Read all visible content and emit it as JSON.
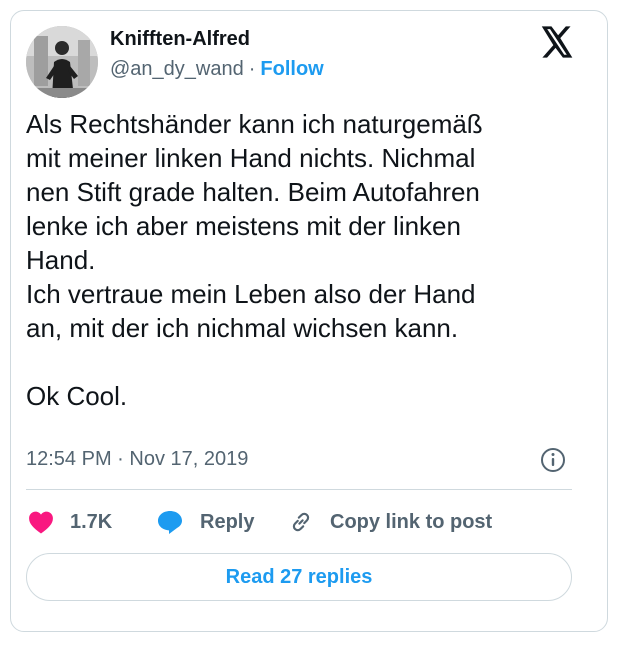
{
  "author": {
    "display_name": "Knifften-Alfred",
    "handle": "@an_dy_wand",
    "separator": "·",
    "follow_label": "Follow",
    "avatar_icon": "profile-photo"
  },
  "brand": {
    "logo_icon": "x-logo-icon"
  },
  "tweet": {
    "text": "Als Rechtshänder kann ich naturgemäß\nmit meiner linken Hand nichts. Nichmal\nnen Stift grade halten. Beim Autofahren\nlenke ich aber meistens mit der linken\nHand.\nIch vertraue mein Leben also der Hand\nan, mit der ich nichmal wichsen kann.\n\nOk Cool.",
    "timestamp": "12:54 PM · Nov 17, 2019"
  },
  "actions": {
    "like_count": "1.7K",
    "reply_label": "Reply",
    "copy_label": "Copy link to post"
  },
  "footer": {
    "read_replies_label": "Read 27 replies"
  },
  "colors": {
    "accent": "#1d9bf0",
    "like": "#f91880",
    "text_primary": "#0f1419",
    "text_secondary": "#536471",
    "border": "#cfd9de"
  }
}
